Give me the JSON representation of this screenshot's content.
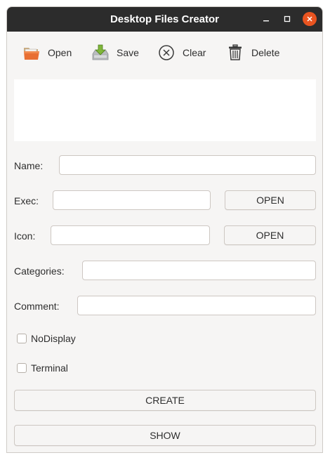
{
  "window": {
    "title": "Desktop Files Creator",
    "controls": {
      "minimize": "minimize-icon",
      "maximize": "maximize-icon",
      "close": "close-icon"
    },
    "accent_color": "#e95420"
  },
  "toolbar": {
    "open_label": "Open",
    "save_label": "Save",
    "clear_label": "Clear",
    "delete_label": "Delete"
  },
  "form": {
    "name_label": "Name:",
    "name_value": "",
    "exec_label": "Exec:",
    "exec_value": "",
    "exec_button": "OPEN",
    "icon_label": "Icon:",
    "icon_value": "",
    "icon_button": "OPEN",
    "categories_label": "Categories:",
    "categories_value": "",
    "comment_label": "Comment:",
    "comment_value": "",
    "nodisplay_label": "NoDisplay",
    "terminal_label": "Terminal",
    "create_button": "CREATE",
    "show_button": "SHOW"
  }
}
